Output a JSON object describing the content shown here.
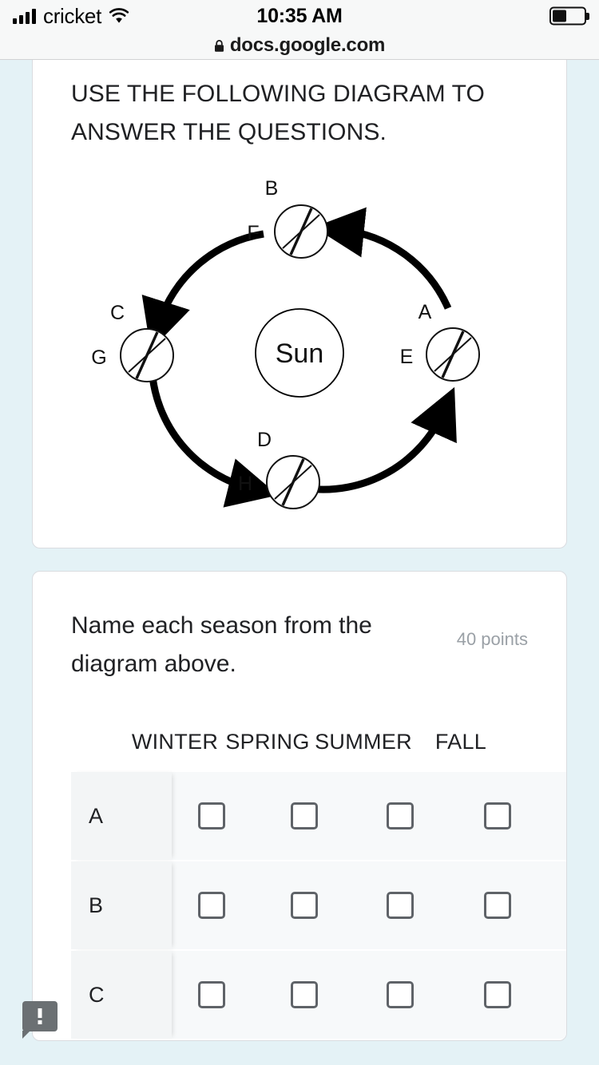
{
  "status_bar": {
    "carrier": "cricket",
    "time": "10:35 AM",
    "signal_icon": "signal-bars-icon",
    "wifi_icon": "wifi-icon",
    "battery_icon": "battery-icon"
  },
  "browser": {
    "lock_icon": "lock-icon",
    "url": "docs.google.com"
  },
  "instruction_card": {
    "text": "USE THE FOLLOWING DIAGRAM TO ANSWER THE QUESTIONS."
  },
  "diagram": {
    "center_label": "Sun",
    "positions": [
      {
        "id": "right",
        "top_label": "A",
        "side_label": "E"
      },
      {
        "id": "top",
        "top_label": "B",
        "side_label": "F"
      },
      {
        "id": "left",
        "top_label": "C",
        "side_label": "G"
      },
      {
        "id": "bottom",
        "top_label": "D",
        "side_label": "H"
      }
    ],
    "arrow_direction": "counterclockwise"
  },
  "question_card": {
    "question": "Name each season from the diagram above.",
    "points": "40 points",
    "columns": [
      "WINTER",
      "SPRING",
      "SUMMER",
      "FALL"
    ],
    "rows": [
      {
        "label": "A",
        "checked": [
          false,
          false,
          false,
          false
        ]
      },
      {
        "label": "B",
        "checked": [
          false,
          false,
          false,
          false
        ]
      },
      {
        "label": "C",
        "checked": [
          false,
          false,
          false,
          false
        ]
      }
    ]
  },
  "comment_badge": {
    "icon": "comment-alert-icon"
  },
  "colors": {
    "page_background": "#e4f2f6",
    "card_background": "#ffffff",
    "text_primary": "#202124",
    "text_muted": "#9aa0a6",
    "checkbox_border": "#5f6368",
    "row_background": "#f7f9fa",
    "row_label_background": "#f3f5f6"
  }
}
